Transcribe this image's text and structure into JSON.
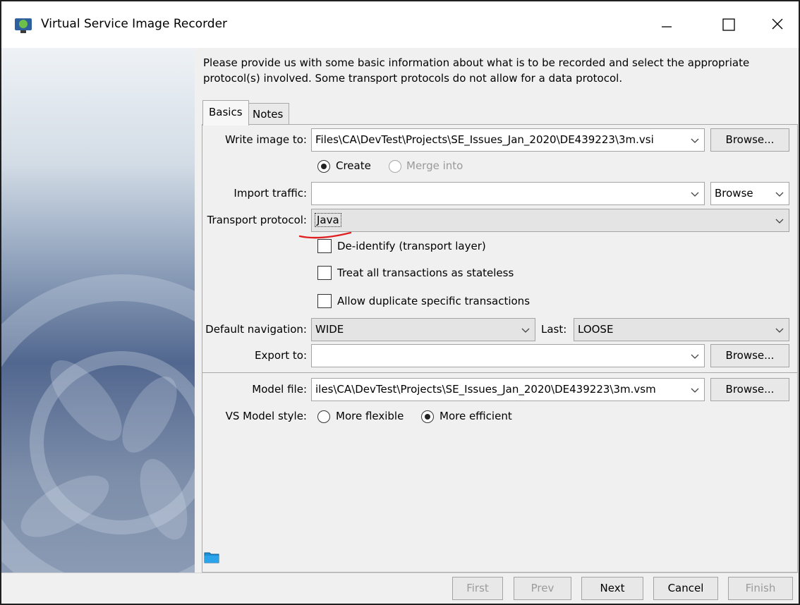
{
  "window": {
    "title": "Virtual Service Image Recorder"
  },
  "intro": "Please provide us with some basic information about what is to be recorded and select the appropriate protocol(s) involved.  Some transport protocols do not allow for a data protocol.",
  "tabs": [
    {
      "label": "Basics",
      "selected": true
    },
    {
      "label": "Notes",
      "selected": false
    }
  ],
  "form": {
    "write_image": {
      "label": "Write image to:",
      "value": "Files\\CA\\DevTest\\Projects\\SE_Issues_Jan_2020\\DE439223\\3m.vsi",
      "button": "Browse..."
    },
    "mode": {
      "create_label": "Create",
      "create_selected": true,
      "merge_label": "Merge into",
      "merge_enabled": false
    },
    "import_traffic": {
      "label": "Import traffic:",
      "value": "",
      "browse_value": "Browse"
    },
    "transport": {
      "label": "Transport protocol:",
      "value": "Java"
    },
    "checkboxes": [
      {
        "label": "De-identify (transport layer)",
        "checked": false
      },
      {
        "label": "Treat all transactions as stateless",
        "checked": false
      },
      {
        "label": "Allow duplicate specific transactions",
        "checked": false
      }
    ],
    "navigation": {
      "label": "Default navigation:",
      "value": "WIDE",
      "last_label": "Last:",
      "last_value": "LOOSE"
    },
    "export": {
      "label": "Export to:",
      "value": "",
      "button": "Browse..."
    },
    "model_file": {
      "label": "Model file:",
      "value": "iles\\CA\\DevTest\\Projects\\SE_Issues_Jan_2020\\DE439223\\3m.vsm",
      "button": "Browse..."
    },
    "model_style": {
      "label": "VS Model style:",
      "flexible_label": "More flexible",
      "efficient_label": "More efficient",
      "selected": "More efficient"
    }
  },
  "footer": {
    "first": "First",
    "prev": "Prev",
    "next": "Next",
    "cancel": "Cancel",
    "finish": "Finish"
  },
  "colors": {
    "annotation_underline": "#e02020",
    "sidebar_dark": "#52678f"
  },
  "icons": {
    "app": "app-icon",
    "minimize": "minimize-icon",
    "maximize": "maximize-icon",
    "close": "close-icon",
    "folder": "folder-icon"
  }
}
